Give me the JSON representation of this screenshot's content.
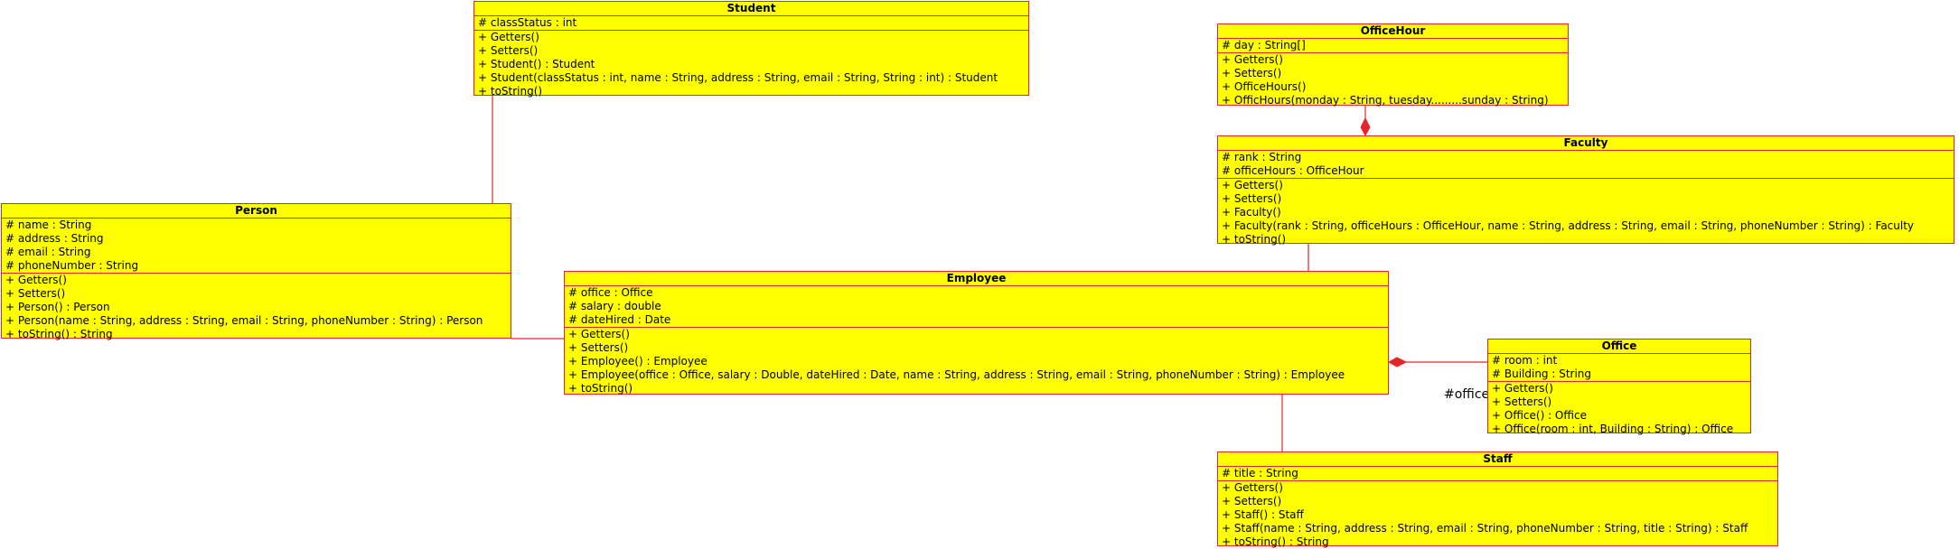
{
  "classes": {
    "student": {
      "name": "Student",
      "attributes": [
        "# classStatus : int"
      ],
      "methods": [
        "+ Getters()",
        "+ Setters()",
        "+ Student() : Student",
        "+ Student(classStatus : int, name : String, address : String, email : String, String : int) : Student",
        "+ toString()"
      ]
    },
    "officehour": {
      "name": "OfficeHour",
      "attributes": [
        "# day : String[]"
      ],
      "methods": [
        "+ Getters()",
        "+ Setters()",
        "+ OfficeHours()",
        "+ OfficHours(monday : String, tuesday.........sunday : String)"
      ]
    },
    "faculty": {
      "name": "Faculty",
      "attributes": [
        "# rank : String",
        "# officeHours : OfficeHour"
      ],
      "methods": [
        "+ Getters()",
        "+ Setters()",
        "+ Faculty()",
        "+ Faculty(rank : String, officeHours : OfficeHour, name : String, address : String, email : String, phoneNumber : String) : Faculty",
        "+ toString()"
      ]
    },
    "person": {
      "name": "Person",
      "attributes": [
        "# name : String",
        "# address : String",
        "# email : String",
        "# phoneNumber : String"
      ],
      "methods": [
        "+ Getters()",
        "+ Setters()",
        "+ Person() : Person",
        "+ Person(name : String, address : String, email : String, phoneNumber : String) : Person",
        "+ toString() : String"
      ]
    },
    "employee": {
      "name": "Employee",
      "attributes": [
        "# office : Office",
        "# salary : double",
        "# dateHired : Date"
      ],
      "methods": [
        "+ Getters()",
        "+ Setters()",
        "+ Employee() : Employee",
        "+ Employee(office : Office, salary : Double, dateHired : Date, name : String, address : String, email : String, phoneNumber : String) : Employee",
        "+ toString()"
      ]
    },
    "office": {
      "name": "Office",
      "attributes": [
        "# room : int",
        "# Building : String"
      ],
      "methods": [
        "+ Getters()",
        "+ Setters()",
        "+ Office() : Office",
        "+ Office(room : int, Building : String) : Office"
      ]
    },
    "staff": {
      "name": "Staff",
      "attributes": [
        "# title : String"
      ],
      "methods": [
        "+ Getters()",
        "+ Setters()",
        "+ Staff() : Staff",
        "+ Staff(name : String, address : String, email : String, phoneNumber : String, title : String) : Staff",
        "+ toString() : String"
      ]
    }
  },
  "relation_labels": {
    "office_role": "#office"
  },
  "colors": {
    "fill": "#ffff00",
    "line": "#e3262a"
  }
}
